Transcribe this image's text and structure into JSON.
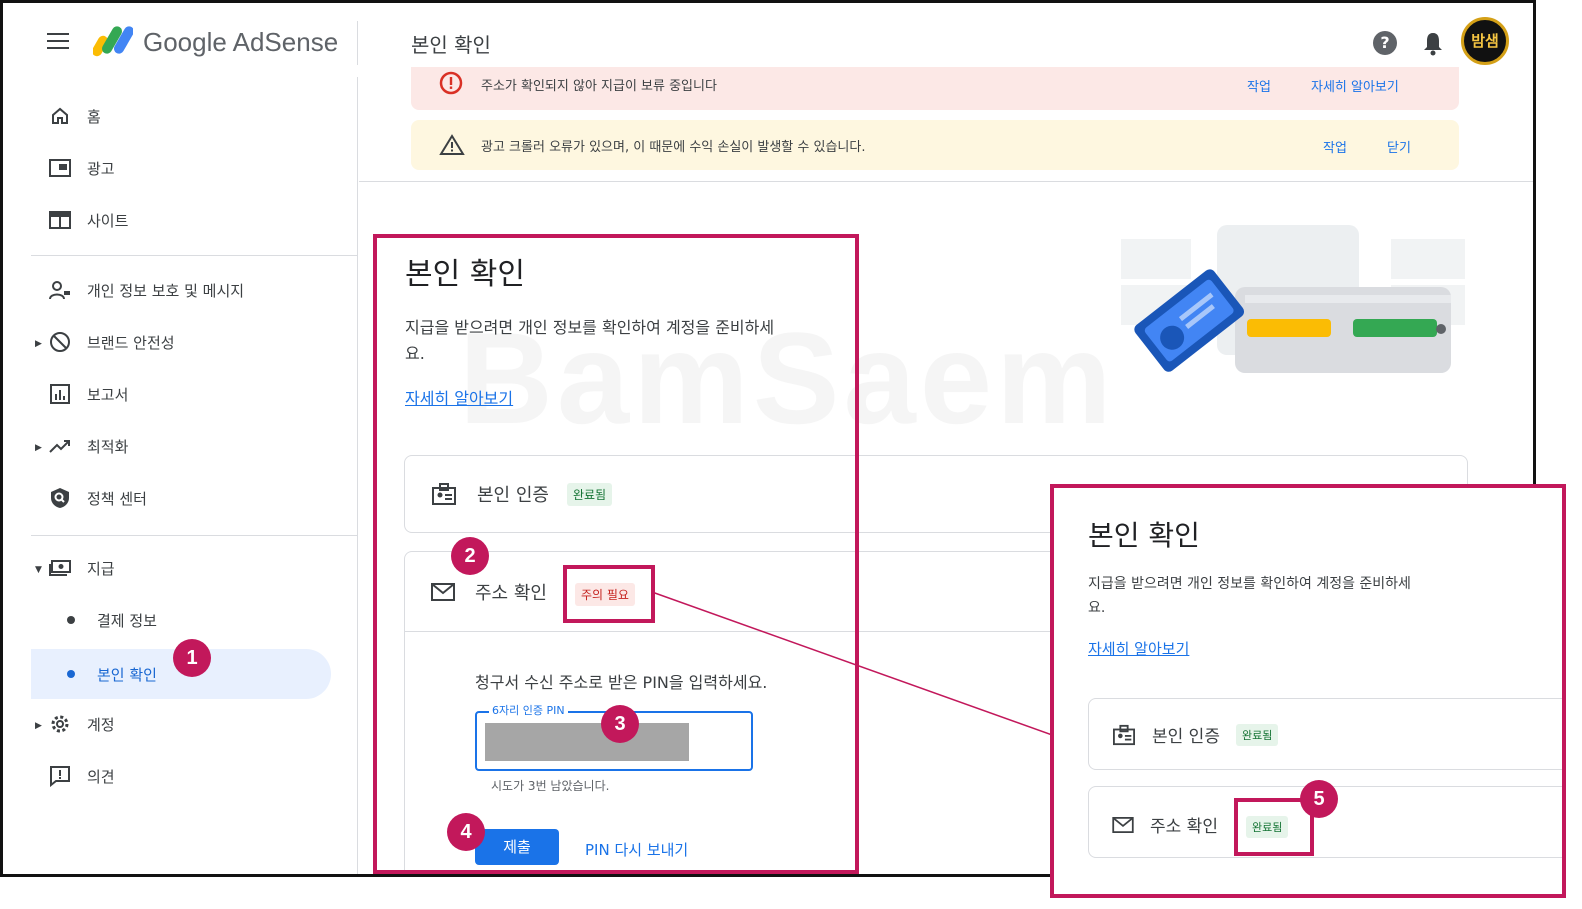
{
  "header": {
    "app_name": "Google AdSense",
    "page_title": "본인 확인",
    "avatar_text": "밤샘"
  },
  "sidebar": {
    "items": [
      {
        "label": "홈",
        "icon": "home-icon"
      },
      {
        "label": "광고",
        "icon": "ads-icon"
      },
      {
        "label": "사이트",
        "icon": "sites-icon"
      },
      {
        "label": "개인 정보 보호 및 메시지",
        "icon": "privacy-icon"
      },
      {
        "label": "브랜드 안전성",
        "icon": "block-icon"
      },
      {
        "label": "보고서",
        "icon": "report-icon"
      },
      {
        "label": "최적화",
        "icon": "trend-icon"
      },
      {
        "label": "정책 센터",
        "icon": "policy-icon"
      },
      {
        "label": "지급",
        "icon": "payments-icon"
      },
      {
        "label": "결제 정보",
        "icon": "dot"
      },
      {
        "label": "본인 확인",
        "icon": "dot"
      },
      {
        "label": "계정",
        "icon": "gear-icon"
      },
      {
        "label": "의견",
        "icon": "feedback-icon"
      }
    ]
  },
  "alerts": {
    "red_text": "주소가 확인되지 않아 지급이 보류 중입니다",
    "red_action": "작업",
    "red_learn": "자세히 알아보기",
    "yellow_text": "광고 크롤러 오류가 있으며, 이 때문에 수익 손실이 발생할 수 있습니다.",
    "yellow_action": "작업",
    "yellow_close": "닫기"
  },
  "watermark": "BamSaem",
  "identity": {
    "title": "본인 확인",
    "desc_line1": "지급을 받으려면 개인 정보를 확인하여 계정을 준비하세",
    "desc_line2": "요.",
    "learn_more": "자세히 알아보기",
    "id_verify_label": "본인 인증",
    "id_verify_status": "완료됨",
    "address_label": "주소 확인",
    "address_status": "주의 필요",
    "pin_instruction": "청구서 수신 주소로 받은 PIN을 입력하세요.",
    "pin_field_label": "6자리 인증 PIN",
    "pin_hint": "시도가 3번 남았습니다.",
    "submit_label": "제출",
    "resend_label": "PIN 다시 보내기"
  },
  "inset": {
    "title": "본인 확인",
    "desc_line1": "지급을 받으려면 개인 정보를 확인하여 계정을 준비하세",
    "desc_line2": "요.",
    "learn_more": "자세히 알아보기",
    "id_verify_label": "본인 인증",
    "id_verify_status": "완료됨",
    "address_label": "주소 확인",
    "address_status": "완료됨"
  },
  "steps": [
    "1",
    "2",
    "3",
    "4",
    "5"
  ],
  "colors": {
    "accent": "#1a73e8",
    "highlight": "#c2185b",
    "success_bg": "#e6f4ea",
    "warn_bg": "#fce8e6",
    "alert_yellow": "#fef7e0"
  }
}
